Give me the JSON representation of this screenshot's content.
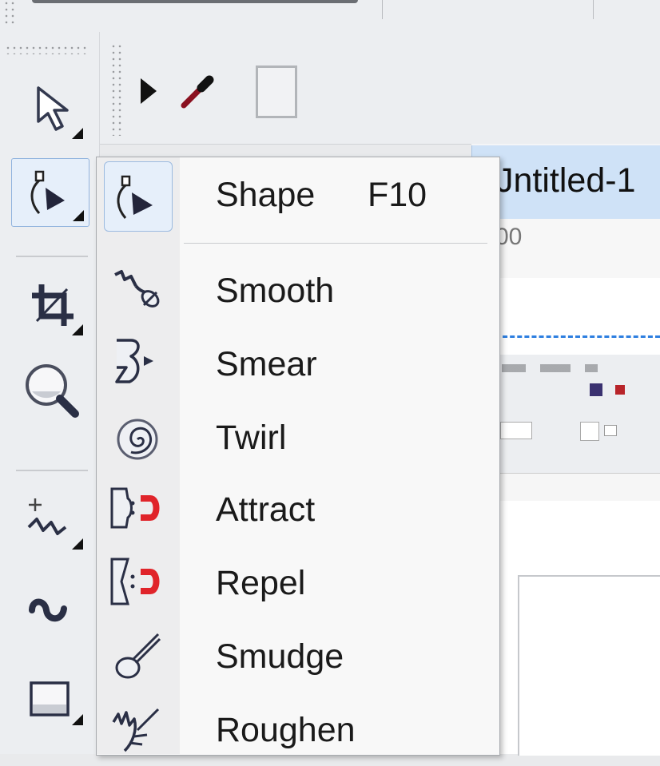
{
  "document": {
    "tab_title": "Jntitled-1",
    "ruler_label": "00"
  },
  "toolbox": {
    "tools": [
      {
        "name": "pick-tool"
      },
      {
        "name": "shape-tool",
        "active": true
      },
      {
        "name": "crop-tool"
      },
      {
        "name": "zoom-tool"
      },
      {
        "name": "freehand-tool"
      },
      {
        "name": "artistic-media-tool"
      },
      {
        "name": "rectangle-tool"
      }
    ]
  },
  "property_bar": {
    "icons": [
      "play-arrow-icon",
      "eyedropper-icon",
      "color-swatch"
    ]
  },
  "flyout": {
    "items": [
      {
        "label": "Shape",
        "shortcut": "F10",
        "icon": "shape-tool-icon",
        "selected": true
      },
      {
        "label": "Smooth",
        "icon": "smooth-tool-icon"
      },
      {
        "label": "Smear",
        "icon": "smear-tool-icon"
      },
      {
        "label": "Twirl",
        "icon": "twirl-tool-icon"
      },
      {
        "label": "Attract",
        "icon": "attract-tool-icon"
      },
      {
        "label": "Repel",
        "icon": "repel-tool-icon"
      },
      {
        "label": "Smudge",
        "icon": "smudge-tool-icon"
      },
      {
        "label": "Roughen",
        "icon": "roughen-tool-icon"
      }
    ]
  },
  "colors": {
    "accent": "#90b3de",
    "magnet_red": "#e0242a",
    "icon_dark": "#2b2f44"
  }
}
